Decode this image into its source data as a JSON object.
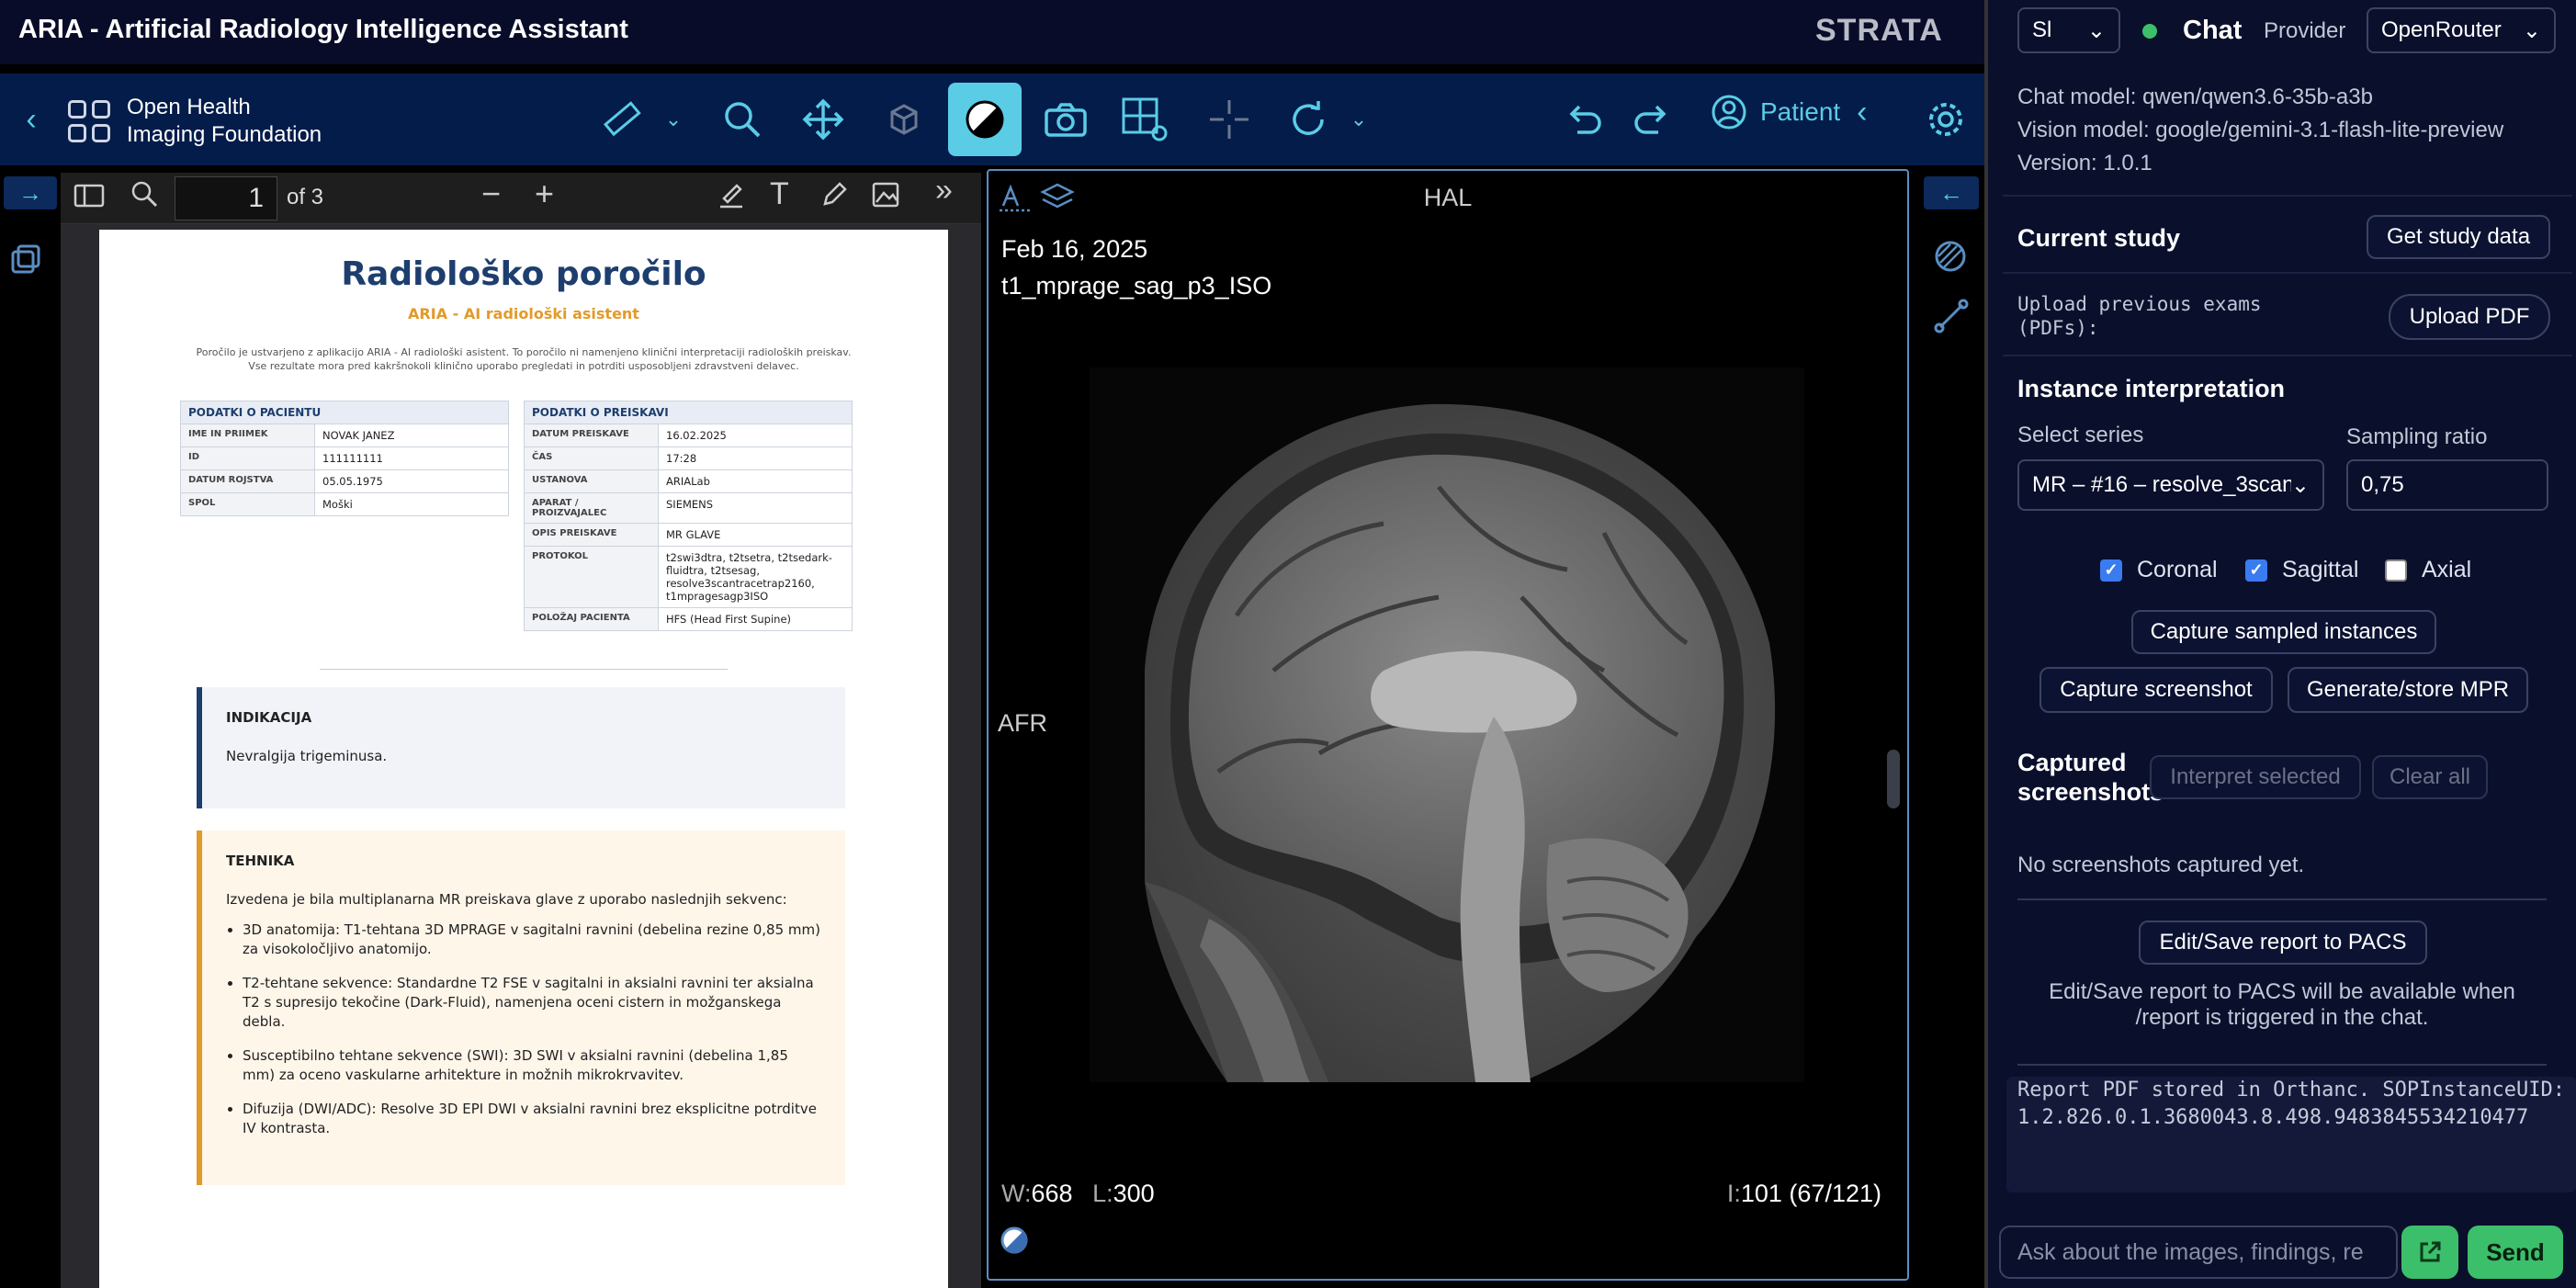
{
  "app": {
    "title": "ARIA - Artificial Radiology Intelligence Assistant",
    "brand": "STRATA"
  },
  "toolbar": {
    "org_line1": "Open Health",
    "org_line2": "Imaging Foundation",
    "patient_label": "Patient",
    "accent": "#5acce6"
  },
  "pdf": {
    "current_page": "1",
    "of_label": "of 3",
    "report": {
      "title": "Radiološko poročilo",
      "subtitle": "ARIA - AI radiološki asistent",
      "disclaimer": "Poročilo je ustvarjeno z aplikacijo ARIA - AI radiološki asistent. To poročilo ni namenjeno klinični interpretaciji radioloških preiskav. Vse rezultate mora pred kakršnokoli klinično uporabo pregledati in potrditi usposobljeni zdravstveni delavec.",
      "patient_header": "PODATKI O PACIENTU",
      "patient_rows": [
        {
          "k": "IME IN PRIIMEK",
          "v": "NOVAK JANEZ"
        },
        {
          "k": "ID",
          "v": "111111111"
        },
        {
          "k": "DATUM ROJSTVA",
          "v": "05.05.1975"
        },
        {
          "k": "SPOL",
          "v": "Moški"
        }
      ],
      "exam_header": "PODATKI O PREISKAVI",
      "exam_rows": [
        {
          "k": "DATUM PREISKAVE",
          "v": "16.02.2025"
        },
        {
          "k": "ČAS",
          "v": "17:28"
        },
        {
          "k": "USTANOVA",
          "v": "ARIALab"
        },
        {
          "k": "APARAT / PROIZVAJALEC",
          "v": "SIEMENS"
        },
        {
          "k": "OPIS PREISKAVE",
          "v": "MR GLAVE"
        },
        {
          "k": "PROTOKOL",
          "v": "t2swi3dtra, t2tsetra, t2tsedark-fluidtra, t2tsesag, resolve3scantracetrap2160, t1mpragesagp3ISO"
        },
        {
          "k": "POLOŽAJ PACIENTA",
          "v": "HFS (Head First Supine)"
        }
      ],
      "indication_title": "INDIKACIJA",
      "indication_text": "Nevralgija trigeminusa.",
      "technique_title": "TEHNIKA",
      "technique_intro": "Izvedena je bila multiplanarna MR preiskava glave z uporabo naslednjih sekvenc:",
      "technique_items": [
        "3D anatomija: T1-tehtana 3D MPRAGE v sagitalni ravnini (debelina rezine 0,85 mm) za visokoločljivo anatomijo.",
        "T2-tehtane sekvence: Standardne T2 FSE v sagitalni in aksialni ravnini ter aksialna T2 s supresijo tekočine (Dark-Fluid), namenjena oceni cistern in možganskega debla.",
        "Susceptibilno tehtane sekvence (SWI): 3D SWI v aksialni ravnini (debelina 1,85 mm) za oceno vaskularne arhitekture in možnih mikrokrvavitev.",
        "Difuzija (DWI/ADC): Resolve 3D EPI DWI v aksialni ravnini brez eksplicitne potrditve IV kontrasta."
      ]
    }
  },
  "viewer": {
    "orientation_top": "HAL",
    "orientation_left": "AFR",
    "date": "Feb 16, 2025",
    "series": "t1_mprage_sag_p3_ISO",
    "w_label": "W:",
    "w_value": "668",
    "l_label": "L:",
    "l_value": "300",
    "i_label": "I:",
    "i_value": "101 (67/121)"
  },
  "panel": {
    "language": "Sl",
    "chat_title": "Chat",
    "provider_label": "Provider",
    "provider_value": "OpenRouter",
    "chat_model": "Chat model: qwen/qwen3.6-35b-a3b",
    "vision_model": "Vision model: google/gemini-3.1-flash-lite-preview",
    "version": "Version: 1.0.1",
    "current_study": "Current study",
    "get_study_data": "Get study data",
    "upload_label": "Upload previous exams (PDFs):",
    "upload_btn": "Upload PDF",
    "instance_title": "Instance interpretation",
    "select_series_label": "Select series",
    "series_value": "MR – #16 – resolve_3scan",
    "sampling_label": "Sampling ratio",
    "sampling_value": "0,75",
    "cb_coronal": "Coronal",
    "cb_sagittal": "Sagittal",
    "cb_axial": "Axial",
    "capture_sampled": "Capture sampled instances",
    "capture_screenshot": "Capture screenshot",
    "generate_mpr": "Generate/store MPR",
    "captured_title": "Captured screenshots",
    "interpret_selected": "Interpret selected",
    "clear_all": "Clear all",
    "no_screenshots": "No screenshots captured yet.",
    "edit_save": "Edit/Save report to PACS",
    "edit_save_note": "Edit/Save report to PACS will be available when /report is triggered in the chat.",
    "report_line1": "Report PDF stored in Orthanc. SOPInstanceUID:",
    "report_line2": "1.2.826.0.1.3680043.8.498.9483845534210477",
    "chat_placeholder": "Ask about the images, findings, re",
    "send": "Send",
    "status_color": "#3cbf6a"
  }
}
